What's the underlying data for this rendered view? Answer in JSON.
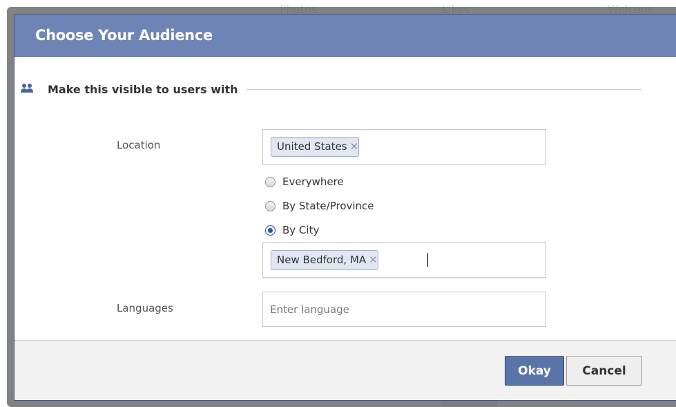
{
  "background": {
    "tabs": [
      "Photos",
      "Likes",
      "Welcom"
    ]
  },
  "dialog": {
    "title": "Choose Your Audience",
    "section_title": "Make this visible to users with",
    "section_icon": "people-icon",
    "location": {
      "label": "Location",
      "tokens": [
        "United States"
      ],
      "options": [
        {
          "label": "Everywhere",
          "checked": false
        },
        {
          "label": "By State/Province",
          "checked": false
        },
        {
          "label": "By City",
          "checked": true
        }
      ],
      "city_tokens": [
        "New Bedford, MA"
      ]
    },
    "languages": {
      "label": "Languages",
      "placeholder": "Enter language",
      "value": ""
    },
    "footer": {
      "okay_label": "Okay",
      "cancel_label": "Cancel"
    },
    "colors": {
      "header_bg": "#6d84b4",
      "header_border": "#3b5998",
      "okay_bg": "#5b74a8",
      "footer_bg": "#f2f2f2"
    }
  }
}
